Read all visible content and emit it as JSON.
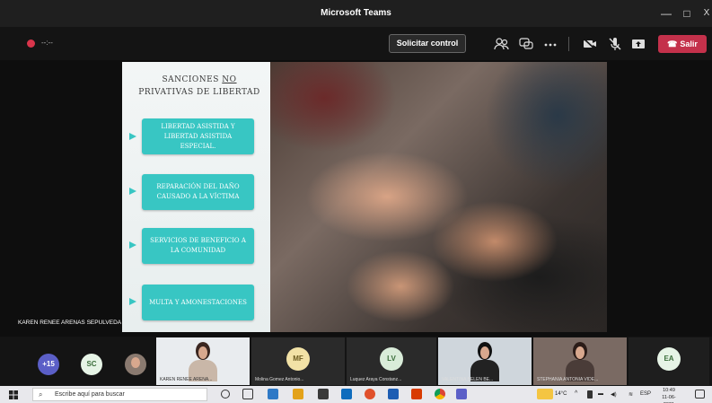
{
  "window": {
    "title": "Microsoft Teams",
    "controls": [
      "—",
      "□",
      "X"
    ]
  },
  "toolbar": {
    "recording_time": "--:--",
    "request_control_label": "Solicitar control",
    "leave_label": "Salir",
    "icons": [
      "participants-icon",
      "chat-icon",
      "more-icon",
      "camera-icon",
      "mic-icon",
      "share-icon"
    ]
  },
  "slide": {
    "title_line1_pre": "SANCIONES ",
    "title_line1_underlined": "NO",
    "title_line2": "PRIVATIVAS DE LIBERTAD",
    "cards": [
      "LIBERTAD ASISTIDA Y LIBERTAD ASISTIDA ESPECIAL.",
      "REPARACIÓN DEL DAÑO CAUSADO A LA VÍCTIMA",
      "SERVICIOS DE BENEFICIO A LA COMUNIDAD",
      "MULTA Y AMONESTACIONES"
    ],
    "accent_color": "#38c6c3"
  },
  "presenter": {
    "name": "KAREN RENEE ARENAS SEPULVEDA"
  },
  "participants": {
    "overflow_count": "+15",
    "avatars": [
      {
        "initials": "SC",
        "color": "#e6f4e6",
        "text_color": "#3b6e3b"
      }
    ],
    "tiles": [
      {
        "name": "KAREN RENEE ARENA...",
        "type": "video"
      },
      {
        "initials": "MF",
        "color": "#f2e2a6",
        "text_color": "#6a5a1e",
        "name": "Molina Gomez Antonio..."
      },
      {
        "initials": "LV",
        "color": "#d9ecd9",
        "text_color": "#3b6e3b",
        "name": "Luquez Araya Constanz..."
      },
      {
        "name": "VALENTINA BELEN BE...",
        "type": "video"
      },
      {
        "name": "STEPHANIA ANTONIA VIDE...",
        "type": "video"
      },
      {
        "initials": "EA",
        "color": "#e6f4e6",
        "text_color": "#3b6e3b",
        "name": ""
      }
    ]
  },
  "taskbar": {
    "search_placeholder": "Escribe aquí para buscar",
    "temperature": "14°C",
    "language": "ESP",
    "time": "10:49",
    "date": "11-06-2021"
  }
}
